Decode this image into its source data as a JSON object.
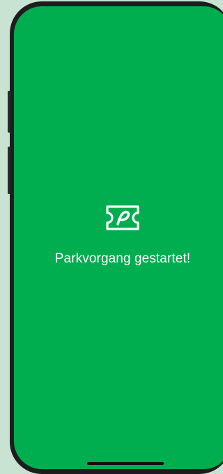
{
  "screen": {
    "icon": "parking-ticket-icon",
    "status_message": "Parkvorgang gestartet!",
    "background_color": "#00ad4f",
    "foreground_color": "#ffffff"
  }
}
